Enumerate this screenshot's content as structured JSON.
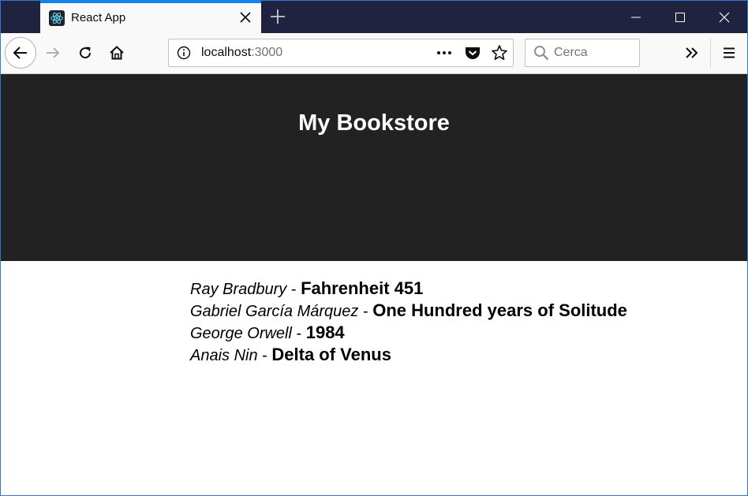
{
  "browser": {
    "tab": {
      "title": "React App",
      "icon": "react-logo-icon"
    },
    "nav": {
      "url_host": "localhost",
      "url_port": ":3000",
      "search_placeholder": "Cerca"
    }
  },
  "app": {
    "header_title": "My Bookstore",
    "header_bg": "#222222",
    "books": [
      {
        "author": "Ray Bradbury",
        "separator": " - ",
        "title": "Fahrenheit 451"
      },
      {
        "author": "Gabriel García Márquez",
        "separator": " - ",
        "title": "One Hundred years of Solitude"
      },
      {
        "author": "George Orwell",
        "separator": " - ",
        "title": "1984"
      },
      {
        "author": "Anais Nin",
        "separator": " - ",
        "title": "Delta of Venus"
      }
    ]
  },
  "colors": {
    "tabbar": "#202340",
    "accent": "#0a84ff",
    "toolbar": "#f9f9fa"
  }
}
